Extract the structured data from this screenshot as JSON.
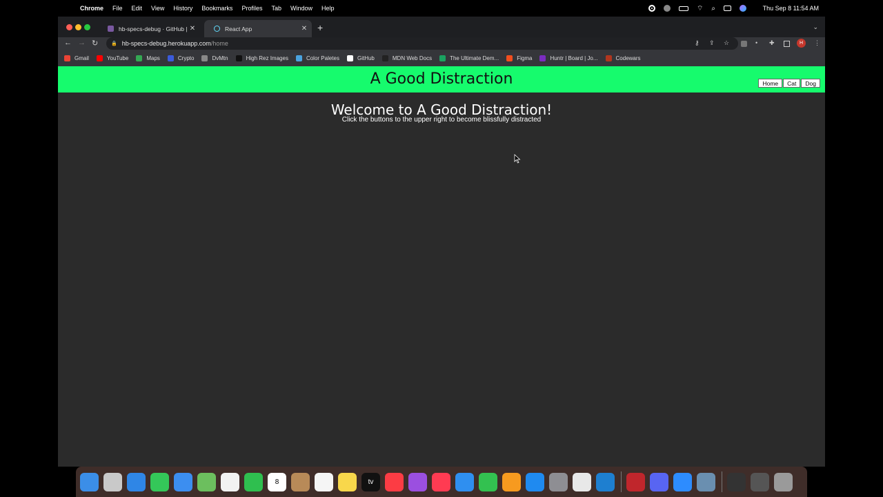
{
  "menubar": {
    "app": "Chrome",
    "menus": [
      "File",
      "Edit",
      "View",
      "History",
      "Bookmarks",
      "Profiles",
      "Tab",
      "Window",
      "Help"
    ],
    "clock": "Thu Sep 8  11:54 AM"
  },
  "tabs": [
    {
      "title": "hb-specs-debug · GitHub | He",
      "close": "✕"
    },
    {
      "title": "React App",
      "close": "✕"
    }
  ],
  "toolbar": {
    "url_host": "hb-specs-debug.herokuapp.com",
    "url_path": "/home",
    "profile_initial": "H"
  },
  "bookmarks": [
    {
      "label": "Gmail",
      "color": "#ea4335"
    },
    {
      "label": "YouTube",
      "color": "#ff0000"
    },
    {
      "label": "Maps",
      "color": "#34a853"
    },
    {
      "label": "Crypto",
      "color": "#3b5bdb"
    },
    {
      "label": "DvMtn",
      "color": "#888888"
    },
    {
      "label": "High Rez Images",
      "color": "#111111"
    },
    {
      "label": "Color Paletes",
      "color": "#4aa3df"
    },
    {
      "label": "GitHub",
      "color": "#ffffff"
    },
    {
      "label": "MDN Web Docs",
      "color": "#222222"
    },
    {
      "label": "The Ultimate Dem...",
      "color": "#1aa260"
    },
    {
      "label": "Figma",
      "color": "#f24e1e"
    },
    {
      "label": "Huntr | Board | Jo...",
      "color": "#7b2cbf"
    },
    {
      "label": "Codewars",
      "color": "#b1361e"
    }
  ],
  "site": {
    "title": "A Good Distraction",
    "nav": {
      "home": "Home",
      "cat": "Cat",
      "dog": "Dog"
    },
    "welcome": "Welcome to A Good Distraction!",
    "subtitle": "Click the buttons to the upper right to become blissfully distracted"
  },
  "dock": [
    {
      "name": "finder",
      "color": "#3b8ee8"
    },
    {
      "name": "launchpad",
      "color": "#c9c9c9"
    },
    {
      "name": "safari",
      "color": "#2f86e6"
    },
    {
      "name": "messages",
      "color": "#34c759"
    },
    {
      "name": "mail",
      "color": "#3c8ef0"
    },
    {
      "name": "maps",
      "color": "#6cbf5e"
    },
    {
      "name": "photos",
      "color": "#f2f2f2"
    },
    {
      "name": "facetime",
      "color": "#2fbf4f"
    },
    {
      "name": "calendar",
      "color": "#ffffff",
      "label": "8"
    },
    {
      "name": "contacts",
      "color": "#b88a58"
    },
    {
      "name": "reminders",
      "color": "#f5f5f5"
    },
    {
      "name": "notes",
      "color": "#f8d74b"
    },
    {
      "name": "tv",
      "color": "#111111",
      "label": "tv"
    },
    {
      "name": "music",
      "color": "#fc3c44"
    },
    {
      "name": "podcasts",
      "color": "#9b4fe0"
    },
    {
      "name": "news",
      "color": "#ff3b52"
    },
    {
      "name": "keynote",
      "color": "#2f8ff0"
    },
    {
      "name": "numbers",
      "color": "#33c150"
    },
    {
      "name": "pages",
      "color": "#f79a1f"
    },
    {
      "name": "app-store",
      "color": "#1f8af0"
    },
    {
      "name": "system-preferences",
      "color": "#8e8e93"
    },
    {
      "name": "chrome",
      "color": "#e8e8e8"
    },
    {
      "name": "vscode",
      "color": "#1e7fd0"
    },
    {
      "name": "sep",
      "color": ""
    },
    {
      "name": "screen-recorder",
      "color": "#c0262c"
    },
    {
      "name": "discord",
      "color": "#5865f2"
    },
    {
      "name": "zoom",
      "color": "#2d8cff"
    },
    {
      "name": "quicktime",
      "color": "#6a8fb0"
    },
    {
      "name": "sep",
      "color": ""
    },
    {
      "name": "downloads",
      "color": "#333333"
    },
    {
      "name": "window-thumbnail",
      "color": "#555555"
    },
    {
      "name": "trash",
      "color": "#9a9a9a"
    }
  ]
}
